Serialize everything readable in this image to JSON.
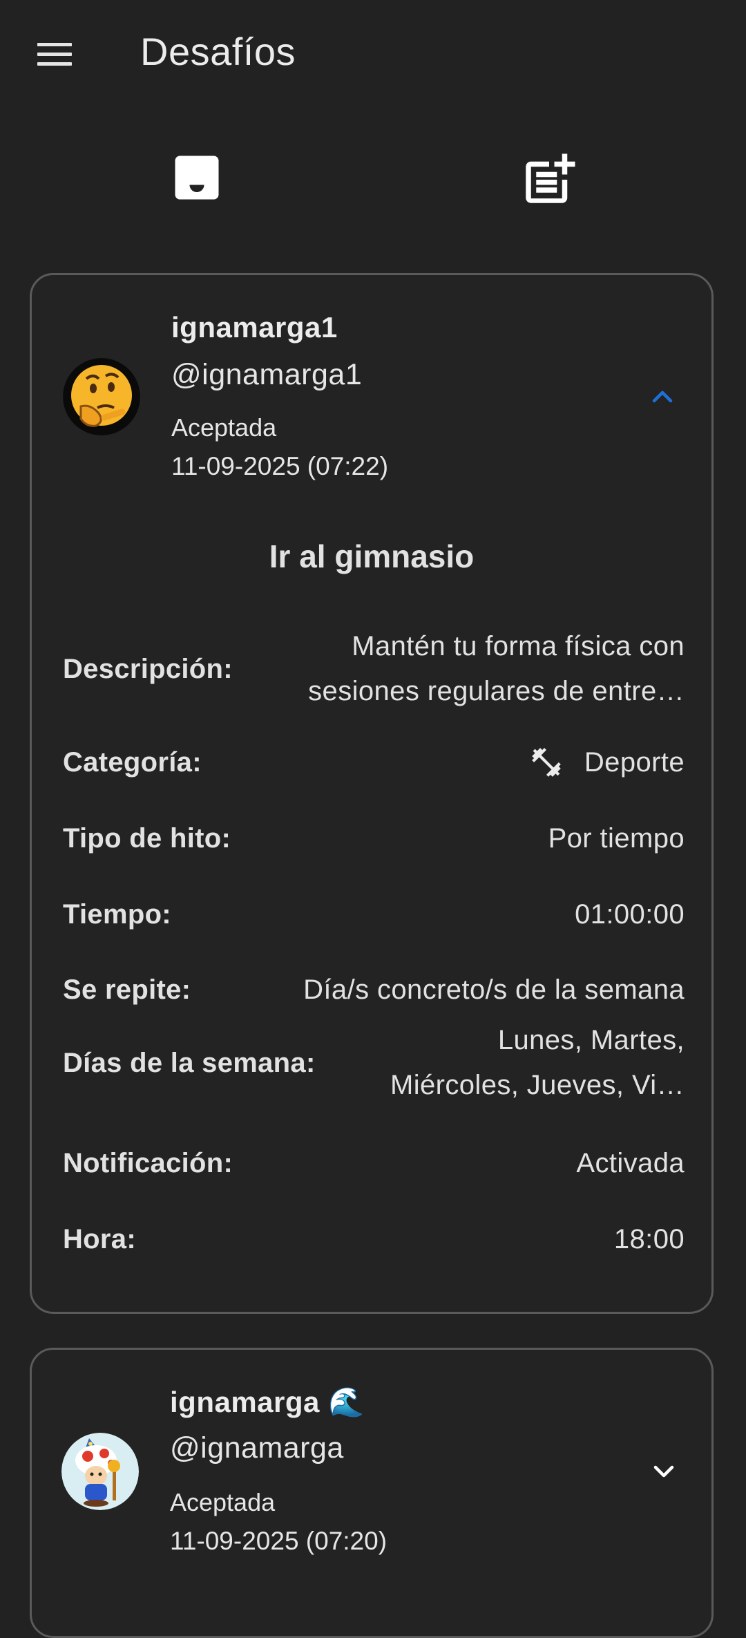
{
  "app": {
    "title": "Desafíos"
  },
  "icons": {
    "menu": "menu-icon",
    "inbox_tab": "inbox-icon",
    "new_challenge_tab": "post-add-icon",
    "category": "fitness-dumbbell-icon",
    "collapse": "chevron-up-icon",
    "expand": "chevron-down-icon"
  },
  "colors": {
    "background": "#222222",
    "card_border": "#5a5a5a",
    "accent": "#1e6fd9",
    "text": "#e6e6e6"
  },
  "challenges": [
    {
      "username": "ignamarga1",
      "handle": "@ignamarga1",
      "status": "Aceptada",
      "date": "11-09-2025 (07:22)",
      "expanded": true,
      "avatar": "thinking-face-emoji",
      "title": "Ir al gimnasio",
      "details": {
        "description_label": "Descripción:",
        "description_line1": "Mantén tu forma física con",
        "description_line2": "sesiones regulares de entre…",
        "category_label": "Categoría:",
        "category_value": "Deporte",
        "milestone_label": "Tipo de hito:",
        "milestone_value": "Por tiempo",
        "time_label": "Tiempo:",
        "time_value": "01:00:00",
        "repeat_label": "Se repite:",
        "repeat_value": "Día/s concreto/s de la semana",
        "days_label": "Días de la semana:",
        "days_line1": "Lunes, Martes,",
        "days_line2": "Miércoles, Jueves, Vi…",
        "notification_label": "Notificación:",
        "notification_value": "Activada",
        "hour_label": "Hora:",
        "hour_value": "18:00"
      }
    },
    {
      "username": "ignamarga 🌊",
      "handle": "@ignamarga",
      "status": "Aceptada",
      "date": "11-09-2025 (07:20)",
      "expanded": false,
      "avatar": "toad-wizard-avatar"
    }
  ]
}
